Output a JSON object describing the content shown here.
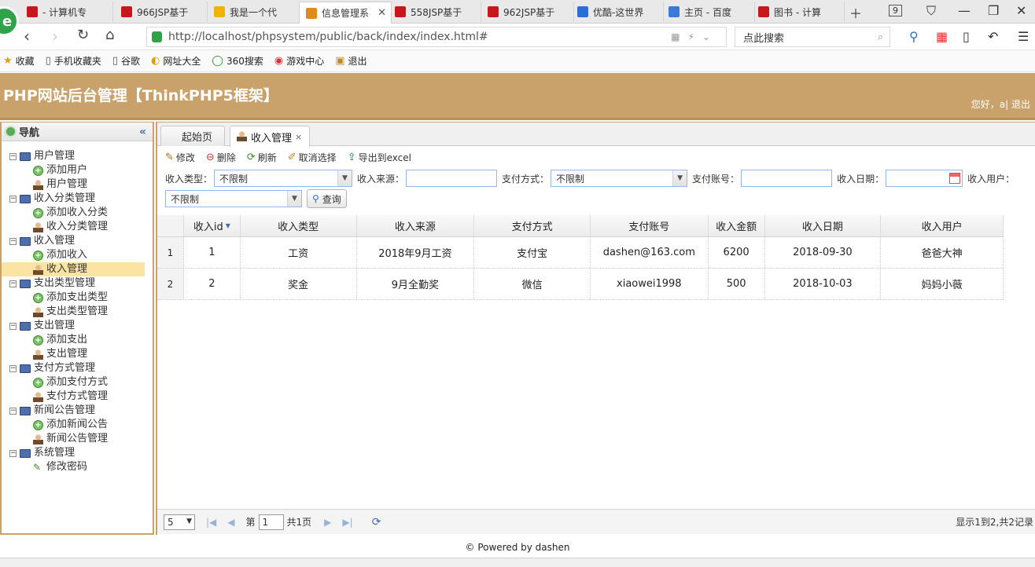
{
  "browser": {
    "tabs": [
      {
        "label": "- 计算机专",
        "color": "#c8161d"
      },
      {
        "label": "966JSP基于",
        "color": "#c8161d"
      },
      {
        "label": "我是一个代",
        "color": "#f0b400"
      },
      {
        "label": "信息管理系",
        "color": "#e08a1e",
        "active": true
      },
      {
        "label": "558JSP基于",
        "color": "#c8161d"
      },
      {
        "label": "962JSP基于",
        "color": "#c8161d"
      },
      {
        "label": "优酷-这世界",
        "color": "#2a6fd6"
      },
      {
        "label": "主页 - 百度",
        "color": "#3a7bd5"
      },
      {
        "label": "图书 - 计算",
        "color": "#c8161d"
      }
    ],
    "tab_count": "9",
    "url": "http://localhost/phpsystem/public/back/index/index.html#",
    "search_placeholder": "点此搜索",
    "bookmarks": [
      {
        "icon": "★",
        "label": "收藏"
      },
      {
        "icon": "▯",
        "label": "手机收藏夹"
      },
      {
        "icon": "▯",
        "label": "谷歌"
      },
      {
        "icon": "◐",
        "label": "网址大全"
      },
      {
        "icon": "◯",
        "label": "360搜索"
      },
      {
        "icon": "◉",
        "label": "游戏中心"
      },
      {
        "icon": "▣",
        "label": "退出"
      }
    ]
  },
  "app": {
    "title": "PHP网站后台管理【ThinkPHP5框架】",
    "welcome": "您好，a",
    "separator": "|",
    "logout": "退出"
  },
  "nav": {
    "title": "导航",
    "groups": [
      {
        "label": "用户管理",
        "children": [
          {
            "label": "添加用户",
            "icon": "add"
          },
          {
            "label": "用户管理",
            "icon": "user"
          }
        ]
      },
      {
        "label": "收入分类管理",
        "children": [
          {
            "label": "添加收入分类",
            "icon": "add"
          },
          {
            "label": "收入分类管理",
            "icon": "user"
          }
        ]
      },
      {
        "label": "收入管理",
        "children": [
          {
            "label": "添加收入",
            "icon": "add"
          },
          {
            "label": "收入管理",
            "icon": "user",
            "selected": true
          }
        ]
      },
      {
        "label": "支出类型管理",
        "children": [
          {
            "label": "添加支出类型",
            "icon": "add"
          },
          {
            "label": "支出类型管理",
            "icon": "user"
          }
        ]
      },
      {
        "label": "支出管理",
        "children": [
          {
            "label": "添加支出",
            "icon": "add"
          },
          {
            "label": "支出管理",
            "icon": "user"
          }
        ]
      },
      {
        "label": "支付方式管理",
        "children": [
          {
            "label": "添加支付方式",
            "icon": "add"
          },
          {
            "label": "支付方式管理",
            "icon": "user"
          }
        ]
      },
      {
        "label": "新闻公告管理",
        "children": [
          {
            "label": "添加新闻公告",
            "icon": "add"
          },
          {
            "label": "新闻公告管理",
            "icon": "user"
          }
        ]
      },
      {
        "label": "系统管理",
        "children": [
          {
            "label": "修改密码",
            "icon": "pen"
          }
        ]
      }
    ]
  },
  "main": {
    "tabs": [
      {
        "label": "起始页"
      },
      {
        "label": "收入管理",
        "closable": true
      }
    ],
    "toolbar": {
      "edit": "修改",
      "delete": "删除",
      "refresh": "刷新",
      "unselect": "取消选择",
      "export": "导出到excel"
    },
    "filters": {
      "income_type_label": "收入类型：",
      "income_type_value": "不限制",
      "income_source_label": "收入来源：",
      "pay_method_label": "支付方式：",
      "pay_method_value": "不限制",
      "pay_account_label": "支付账号：",
      "income_date_label": "收入日期：",
      "income_user_label": "收入用户：",
      "income_user_value": "不限制",
      "query_button": "查询"
    },
    "grid": {
      "columns": [
        "收入id",
        "收入类型",
        "收入来源",
        "支付方式",
        "支付账号",
        "收入金额",
        "收入日期",
        "收入用户"
      ],
      "rows": [
        {
          "rownum": "1",
          "cells": [
            "1",
            "工资",
            "2018年9月工资",
            "支付宝",
            "dashen@163.com",
            "6200",
            "2018-09-30",
            "爸爸大神"
          ]
        },
        {
          "rownum": "2",
          "cells": [
            "2",
            "奖金",
            "9月全勤奖",
            "微信",
            "xiaowei1998",
            "500",
            "2018-10-03",
            "妈妈小薇"
          ]
        }
      ]
    },
    "pager": {
      "page_size": "5",
      "page_prefix": "第",
      "page_value": "1",
      "page_total": "共1页",
      "info": "显示1到2,共2记录"
    }
  },
  "footer": "© Powered by dashen"
}
